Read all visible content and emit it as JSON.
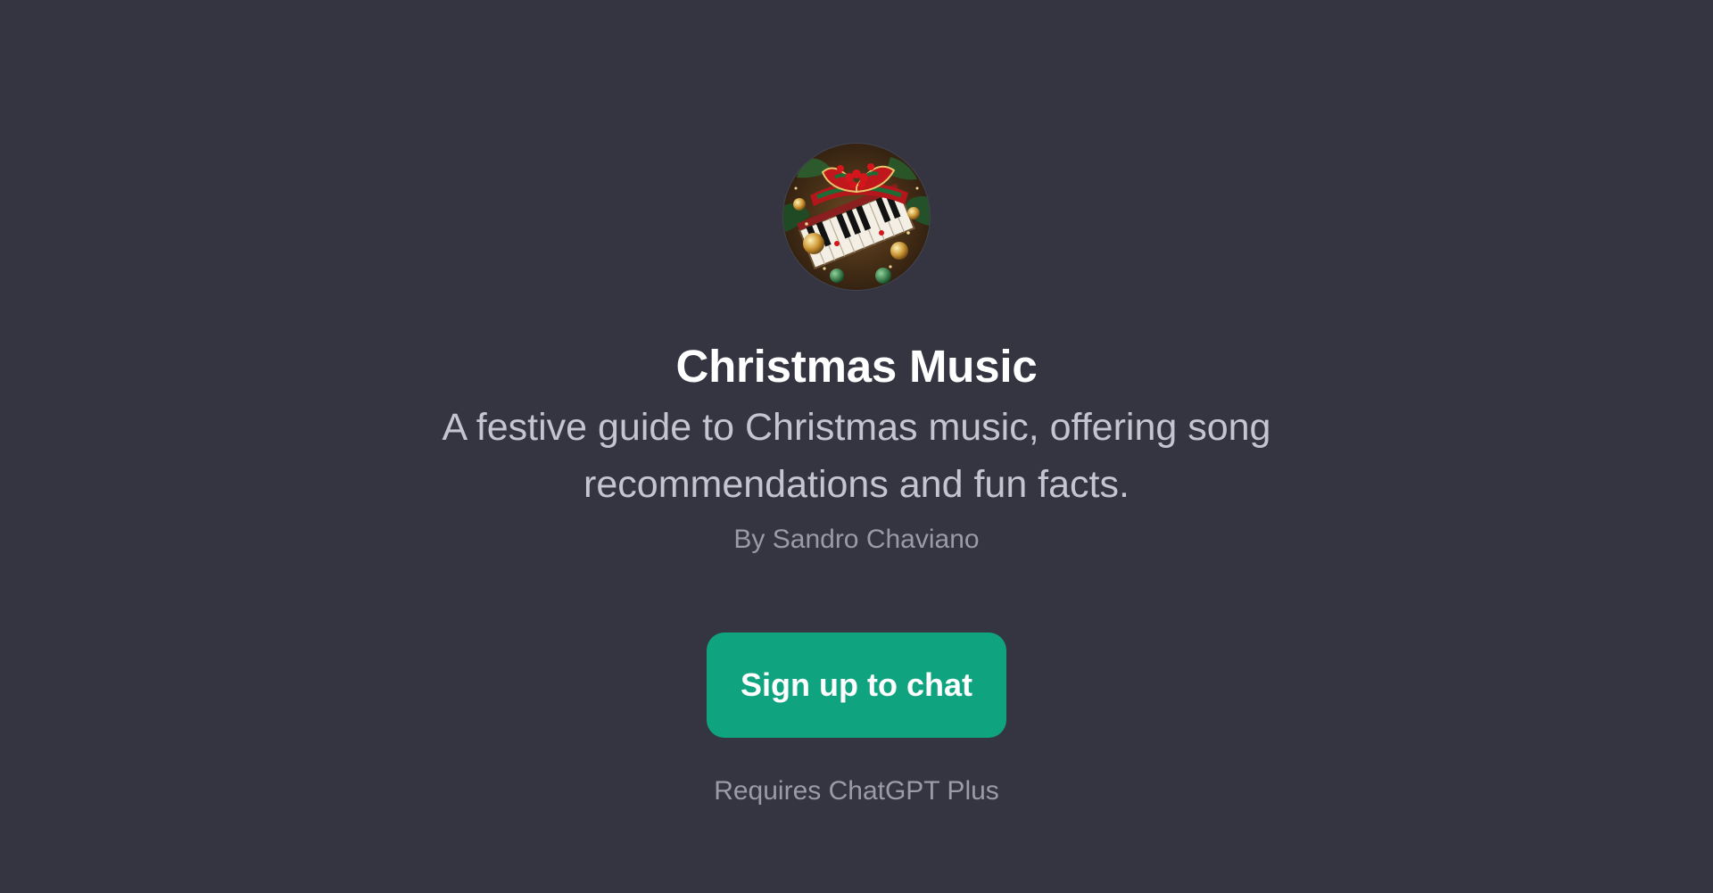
{
  "gpt": {
    "title": "Christmas Music",
    "description": "A festive guide to Christmas music, offering song recommendations and fun facts.",
    "author": "By Sandro Chaviano",
    "avatar_icon": "christmas-piano-wreath-image"
  },
  "cta": {
    "label": "Sign up to chat",
    "color": "#10a37f"
  },
  "footer": {
    "requirement": "Requires ChatGPT Plus"
  },
  "theme": {
    "background": "#343541",
    "title_color": "#ffffff",
    "description_color": "#c5c5d2",
    "muted_color": "#9a9aa8"
  }
}
